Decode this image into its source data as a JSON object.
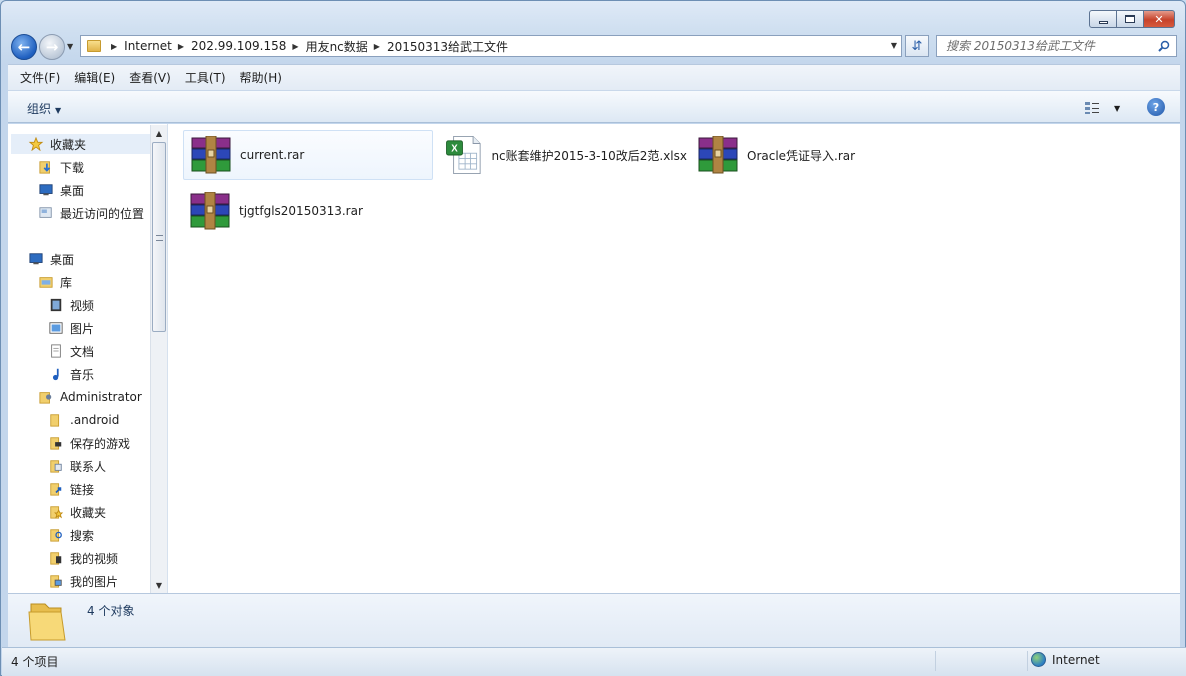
{
  "window": {
    "caption": {
      "minimize": "—",
      "maximize": "□",
      "close": "✕"
    }
  },
  "address": {
    "breadcrumbs": [
      "Internet",
      "202.99.109.158",
      "用友nc数据",
      "20150313给武工文件"
    ]
  },
  "search": {
    "placeholder": "搜索 20150313给武工文件"
  },
  "menu": [
    "文件(F)",
    "编辑(E)",
    "查看(V)",
    "工具(T)",
    "帮助(H)"
  ],
  "toolbar": {
    "organize": "组织"
  },
  "nav": {
    "favorites": "收藏夹",
    "downloads": "下载",
    "desktop_fav": "桌面",
    "recent": "最近访问的位置",
    "desktop": "桌面",
    "libraries": "库",
    "videos": "视频",
    "pictures": "图片",
    "documents": "文档",
    "music": "音乐",
    "admin": "Administrator",
    "android": ".android",
    "saved_games": "保存的游戏",
    "contacts": "联系人",
    "links": "链接",
    "favorites2": "收藏夹",
    "searches": "搜索",
    "my_videos": "我的视频",
    "my_pictures": "我的图片"
  },
  "files": [
    {
      "name": "current.rar",
      "icon": "winrar-archive-icon"
    },
    {
      "name": "nc账套维护2015-3-10改后2范.xlsx",
      "icon": "excel-file-icon"
    },
    {
      "name": "Oracle凭证导入.rar",
      "icon": "winrar-archive-icon"
    },
    {
      "name": "tjgtfgls20150313.rar",
      "icon": "winrar-archive-icon"
    }
  ],
  "details": {
    "object_count": "4 个对象"
  },
  "status": {
    "item_count": "4 个项目",
    "zone": "Internet"
  }
}
